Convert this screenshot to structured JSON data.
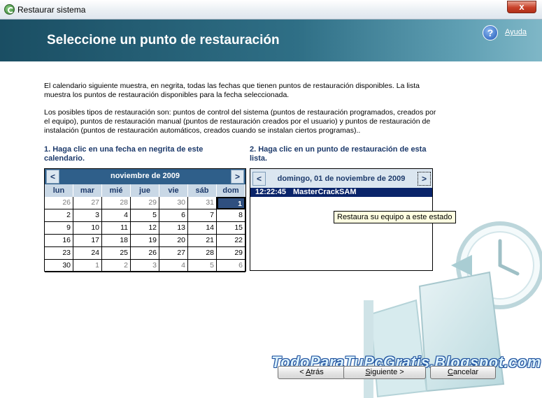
{
  "window": {
    "title": "Restaurar sistema",
    "close_glyph": "x",
    "icon": "system-restore-icon"
  },
  "header": {
    "title": "Seleccione un punto de restauración"
  },
  "help": {
    "glyph": "?",
    "label": "Ayuda"
  },
  "intro": [
    "El calendario siguiente muestra, en negrita, todas las fechas que tienen puntos de restauración disponibles. La lista muestra los puntos de restauración disponibles para la fecha seleccionada.",
    "Los posibles tipos de restauración son: puntos de control del sistema (puntos de restauración programados, creados por el equipo), puntos de restauración manual (puntos de restauración creados por el usuario) y puntos de restauración de instalación (puntos de restauración automáticos, creados cuando se instalan ciertos programas).."
  ],
  "step1": "1. Haga clic en una fecha en negrita de este calendario.",
  "step2": "2. Haga clic en un punto de restauración de esta lista.",
  "calendar": {
    "prev": "<",
    "next": ">",
    "month": "noviembre de 2009",
    "weekdays": [
      "lun",
      "mar",
      "mié",
      "jue",
      "vie",
      "sáb",
      "dom"
    ],
    "weeks": [
      [
        {
          "d": "26",
          "o": true
        },
        {
          "d": "27",
          "o": true
        },
        {
          "d": "28",
          "o": true
        },
        {
          "d": "29",
          "o": true
        },
        {
          "d": "30",
          "o": true
        },
        {
          "d": "31",
          "o": true
        },
        {
          "d": "1",
          "s": true
        }
      ],
      [
        {
          "d": "2"
        },
        {
          "d": "3"
        },
        {
          "d": "4"
        },
        {
          "d": "5"
        },
        {
          "d": "6"
        },
        {
          "d": "7"
        },
        {
          "d": "8"
        }
      ],
      [
        {
          "d": "9"
        },
        {
          "d": "10"
        },
        {
          "d": "11"
        },
        {
          "d": "12"
        },
        {
          "d": "13"
        },
        {
          "d": "14"
        },
        {
          "d": "15"
        }
      ],
      [
        {
          "d": "16"
        },
        {
          "d": "17"
        },
        {
          "d": "18"
        },
        {
          "d": "19"
        },
        {
          "d": "20"
        },
        {
          "d": "21"
        },
        {
          "d": "22"
        }
      ],
      [
        {
          "d": "23"
        },
        {
          "d": "24"
        },
        {
          "d": "25"
        },
        {
          "d": "26"
        },
        {
          "d": "27"
        },
        {
          "d": "28"
        },
        {
          "d": "29"
        }
      ],
      [
        {
          "d": "30"
        },
        {
          "d": "1",
          "o": true
        },
        {
          "d": "2",
          "o": true
        },
        {
          "d": "3",
          "o": true
        },
        {
          "d": "4",
          "o": true
        },
        {
          "d": "5",
          "o": true
        },
        {
          "d": "6",
          "o": true
        }
      ]
    ]
  },
  "list": {
    "prev": "<",
    "next": ">",
    "date": "domingo, 01 de noviembre de 2009",
    "items": [
      {
        "time": "12:22:45",
        "name": "MasterCrackSAM"
      }
    ]
  },
  "tooltip": "Restaura su equipo a este estado",
  "watermark": "TodoParaTuPcGratis.Blogspot.com",
  "buttons": {
    "back": {
      "prefix": "< ",
      "mnemonic": "A",
      "rest": "trás"
    },
    "next": {
      "mnemonic": "S",
      "rest": "iguiente",
      "suffix": " >"
    },
    "cancel": {
      "mnemonic": "C",
      "rest": "ancelar"
    }
  },
  "colors": {
    "header": "#2f6f86",
    "selection": "#0a246a",
    "calendar_header": "#2f5f8a"
  }
}
